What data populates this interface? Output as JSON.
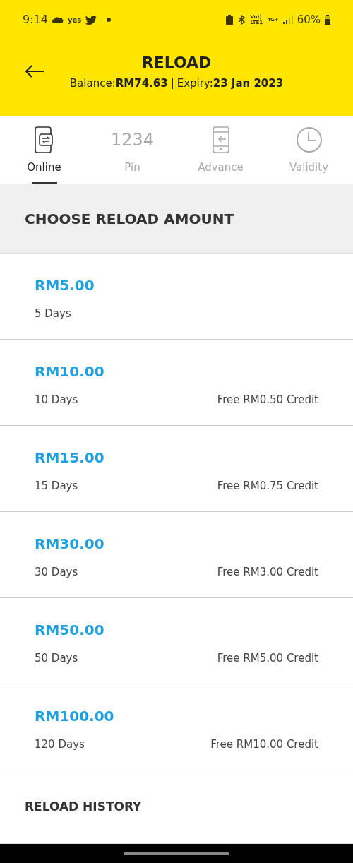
{
  "status_bar": {
    "time": "9:14",
    "carrier": "yes",
    "volte_top": "Vo))",
    "volte_bottom": "LTE1",
    "network": "4G+",
    "battery": "60%"
  },
  "header": {
    "title": "RELOAD",
    "balance_label": "Balance:",
    "balance": "RM74.63",
    "expiry_label": "Expiry:",
    "expiry": "23 Jan 2023"
  },
  "tabs": [
    {
      "label": "Online",
      "kind": "sync",
      "selected": true
    },
    {
      "label": "Pin",
      "kind": "digits",
      "digits": "1234",
      "selected": false
    },
    {
      "label": "Advance",
      "kind": "phone",
      "selected": false
    },
    {
      "label": "Validity",
      "kind": "clock",
      "selected": false
    }
  ],
  "section_title": "CHOOSE RELOAD AMOUNT",
  "amounts": [
    {
      "price": "RM5.00",
      "days": "5 Days"
    },
    {
      "price": "RM10.00",
      "days": "10 Days",
      "bonus": "Free RM0.50 Credit"
    },
    {
      "price": "RM15.00",
      "days": "15 Days",
      "bonus": "Free RM0.75 Credit"
    },
    {
      "price": "RM30.00",
      "days": "30 Days",
      "bonus": "Free RM3.00 Credit"
    },
    {
      "price": "RM50.00",
      "days": "50 Days",
      "bonus": "Free RM5.00 Credit"
    },
    {
      "price": "RM100.00",
      "days": "120 Days",
      "bonus": "Free RM10.00 Credit"
    }
  ],
  "history_title": "RELOAD HISTORY"
}
